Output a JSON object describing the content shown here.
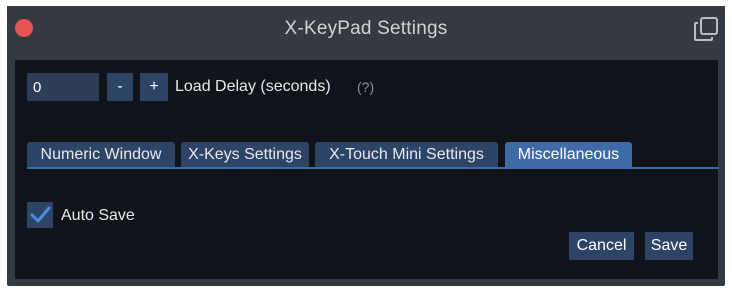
{
  "window": {
    "title": "X-KeyPad Settings",
    "close_icon": "close-icon",
    "popout_icon": "popout-icon"
  },
  "load_delay": {
    "value": "0",
    "minus_label": "-",
    "plus_label": "+",
    "label": "Load Delay (seconds)",
    "help_label": "(?)"
  },
  "tabs": [
    {
      "label": "Numeric Window",
      "active": false
    },
    {
      "label": "X-Keys Settings",
      "active": false
    },
    {
      "label": "X-Touch Mini Settings",
      "active": false
    },
    {
      "label": "Miscellaneous",
      "active": true
    }
  ],
  "misc": {
    "auto_save_label": "Auto Save",
    "auto_save_checked": true,
    "check_icon": "checkmark-icon"
  },
  "actions": {
    "cancel_label": "Cancel",
    "save_label": "Save"
  },
  "colors": {
    "titlebar": "#343a40",
    "content_bg": "#10141a",
    "button": "#2d4467",
    "active_tab": "#3e6aa8",
    "close_dot": "#e45454",
    "checkmark": "#4f8de0"
  }
}
